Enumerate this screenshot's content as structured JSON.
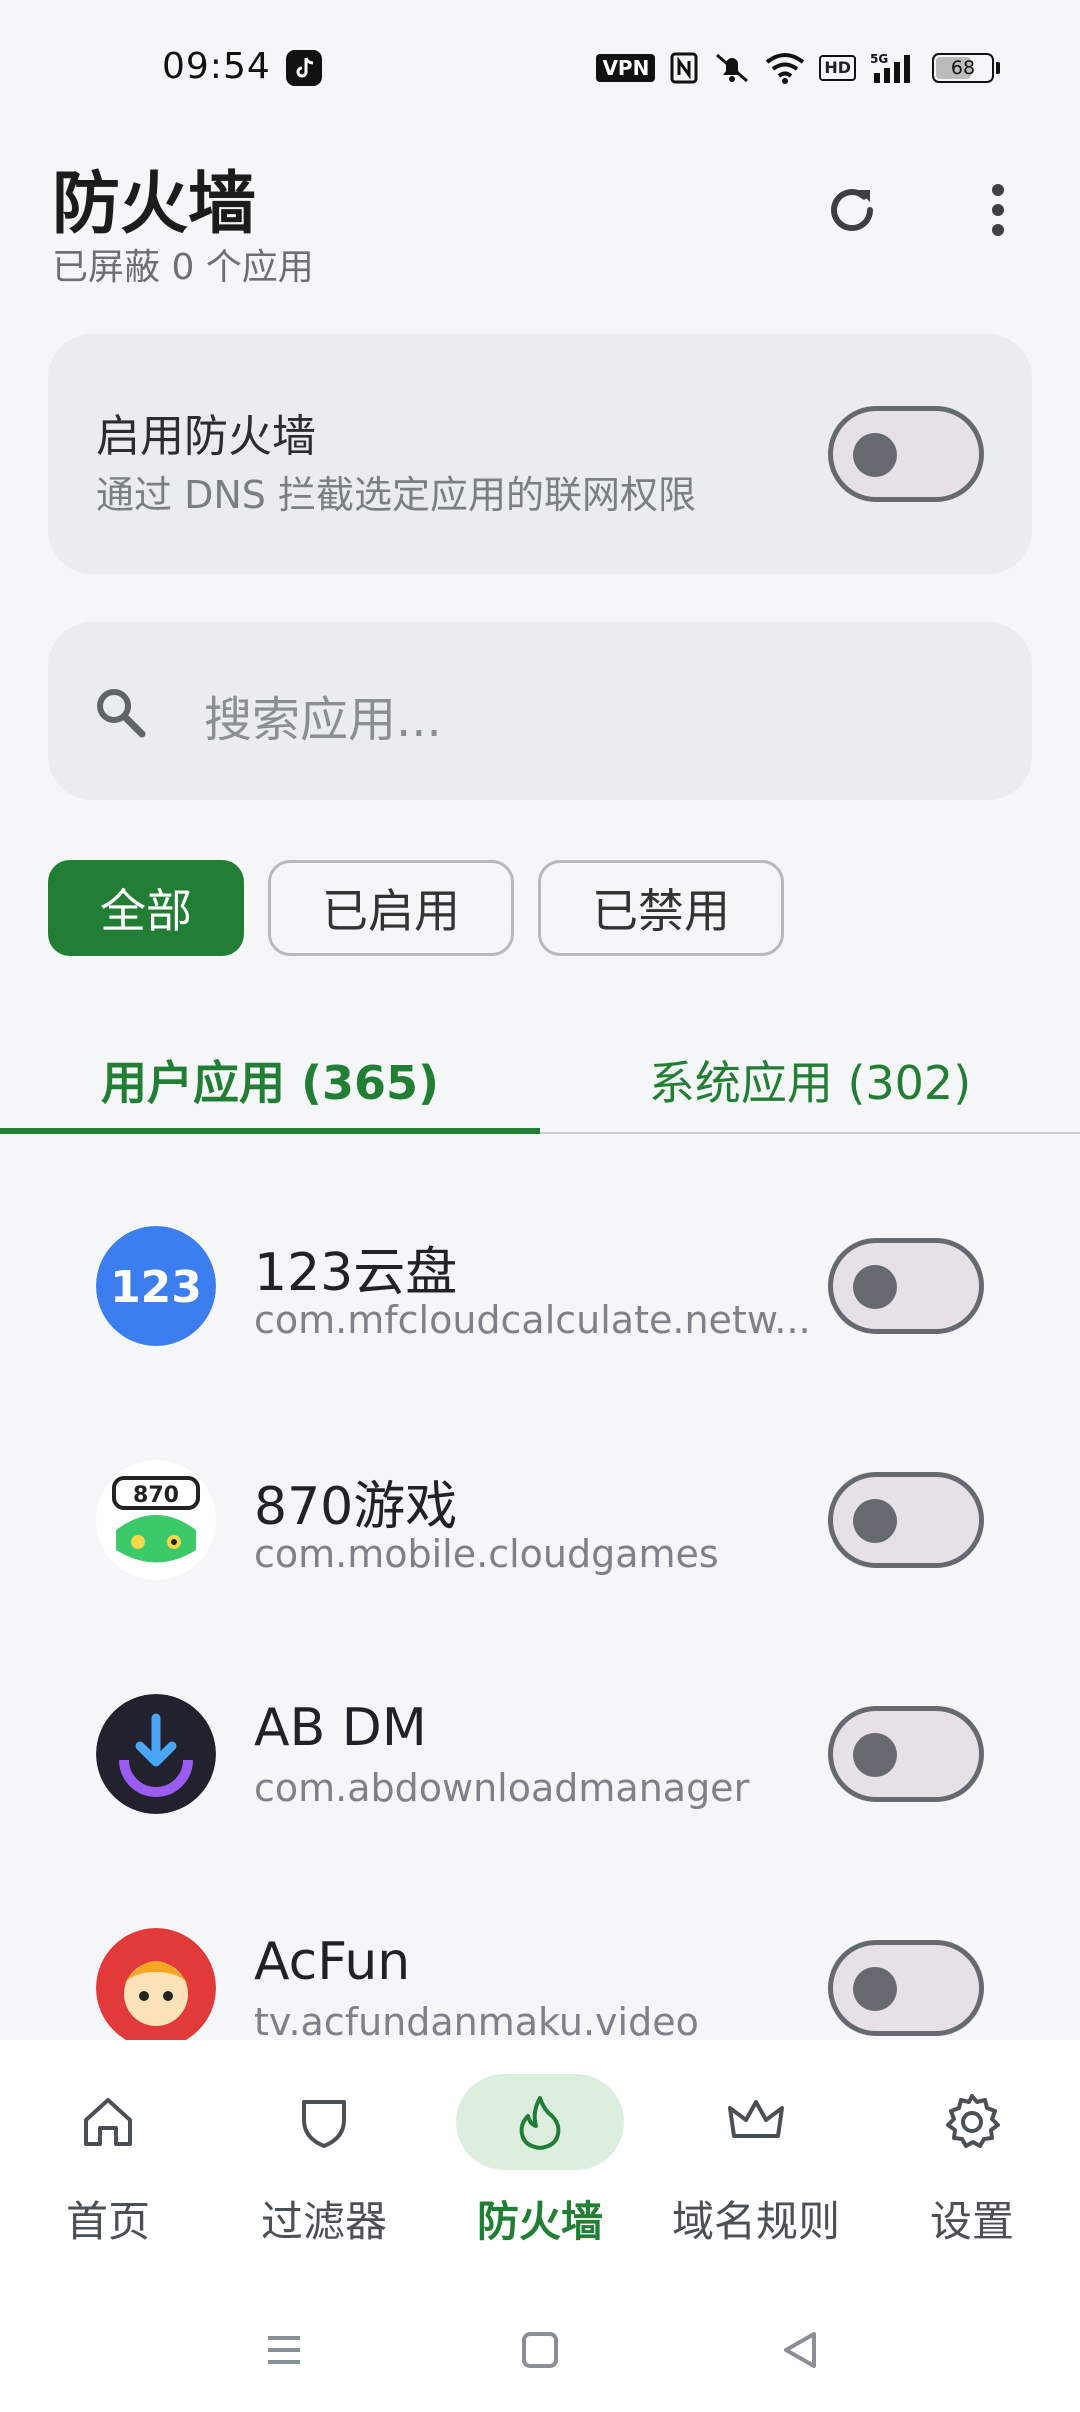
{
  "status_bar": {
    "time": "09:54",
    "vpn_label": "VPN",
    "hd_label": "HD",
    "network_label": "5G",
    "battery_level": "68",
    "battery_fraction": 0.68
  },
  "header": {
    "title": "防火墙",
    "subtitle": "已屏蔽 0 个应用"
  },
  "firewall_card": {
    "title": "启用防火墙",
    "description": "通过 DNS 拦截选定应用的联网权限",
    "enabled": false
  },
  "search": {
    "placeholder": "搜索应用..."
  },
  "filters": {
    "all": "全部",
    "enabled": "已启用",
    "disabled": "已禁用",
    "selected": "全部"
  },
  "tabs": {
    "user": "用户应用 (365)",
    "system": "系统应用 (302)",
    "selected": "user"
  },
  "apps": [
    {
      "name": "123云盘",
      "package": "com.mfcloudcalculate.netw...",
      "icon": "app-123-icon",
      "enabled": false
    },
    {
      "name": "870游戏",
      "package": "com.mobile.cloudgames",
      "icon": "app-870-icon",
      "enabled": false
    },
    {
      "name": "AB DM",
      "package": "com.abdownloadmanager",
      "icon": "app-abdm-icon",
      "enabled": false
    },
    {
      "name": "AcFun",
      "package": "tv.acfundanmaku.video",
      "icon": "app-acfun-icon",
      "enabled": false
    }
  ],
  "bottom_nav": {
    "home": "首页",
    "filters": "过滤器",
    "firewall": "防火墙",
    "domain_rules": "域名规则",
    "settings": "设置",
    "active": "firewall"
  },
  "colors": {
    "accent": "#237e35",
    "accent_light": "#dcefdf",
    "background": "#f4f6f8",
    "card": "#e9edf0"
  }
}
